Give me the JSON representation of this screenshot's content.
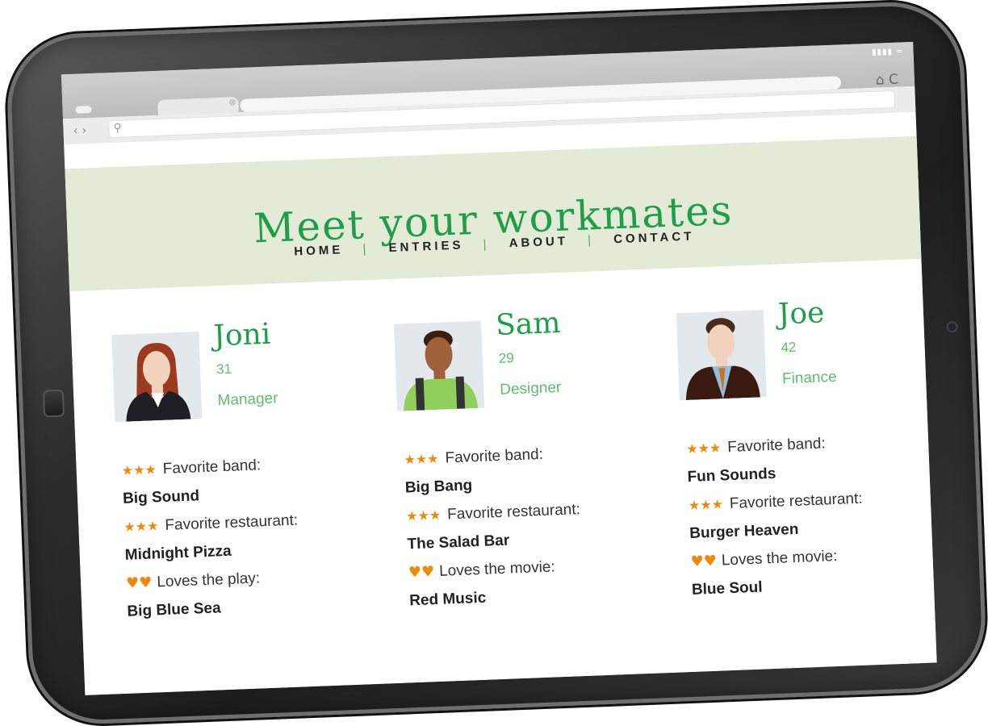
{
  "browser": {
    "signal": "▮▮▮▮ ≈",
    "tab_close": "⊗",
    "nav_arrows": "‹ ›",
    "toolbar_icons": "⌂ C",
    "search_icon": "⚲"
  },
  "page": {
    "title": "Meet your workmates",
    "nav": [
      "HOME",
      "ENTRIES",
      "ABOUT",
      "CONTACT"
    ],
    "nav_separator": "|"
  },
  "people": [
    {
      "name": "Joni",
      "age": "31",
      "role": "Manager",
      "facts": [
        {
          "rating_icon": "★★★",
          "label": "Favorite band:",
          "value": "Big Sound"
        },
        {
          "rating_icon": "★★★",
          "label": "Favorite restaurant:",
          "value": "Midnight Pizza"
        },
        {
          "rating_icon": "♥♥",
          "label": "Loves the play:",
          "value": "Big Blue Sea"
        }
      ]
    },
    {
      "name": "Sam",
      "age": "29",
      "role": "Designer",
      "facts": [
        {
          "rating_icon": "★★★",
          "label": "Favorite band:",
          "value": "Big Bang"
        },
        {
          "rating_icon": "★★★",
          "label": "Favorite restaurant:",
          "value": "The Salad Bar"
        },
        {
          "rating_icon": "♥♥",
          "label": "Loves the movie:",
          "value": "Red Music"
        }
      ]
    },
    {
      "name": "Joe",
      "age": "42",
      "role": "Finance",
      "facts": [
        {
          "rating_icon": "★★★",
          "label": "Favorite band:",
          "value": "Fun Sounds"
        },
        {
          "rating_icon": "★★★",
          "label": "Favorite restaurant:",
          "value": "Burger Heaven"
        },
        {
          "rating_icon": "♥♥",
          "label": "Loves the movie:",
          "value": "Blue Soul"
        }
      ]
    }
  ],
  "colors": {
    "accent_green": "#1f9e4a",
    "header_band": "#e3ead6",
    "rating_orange": "#f0880a"
  }
}
